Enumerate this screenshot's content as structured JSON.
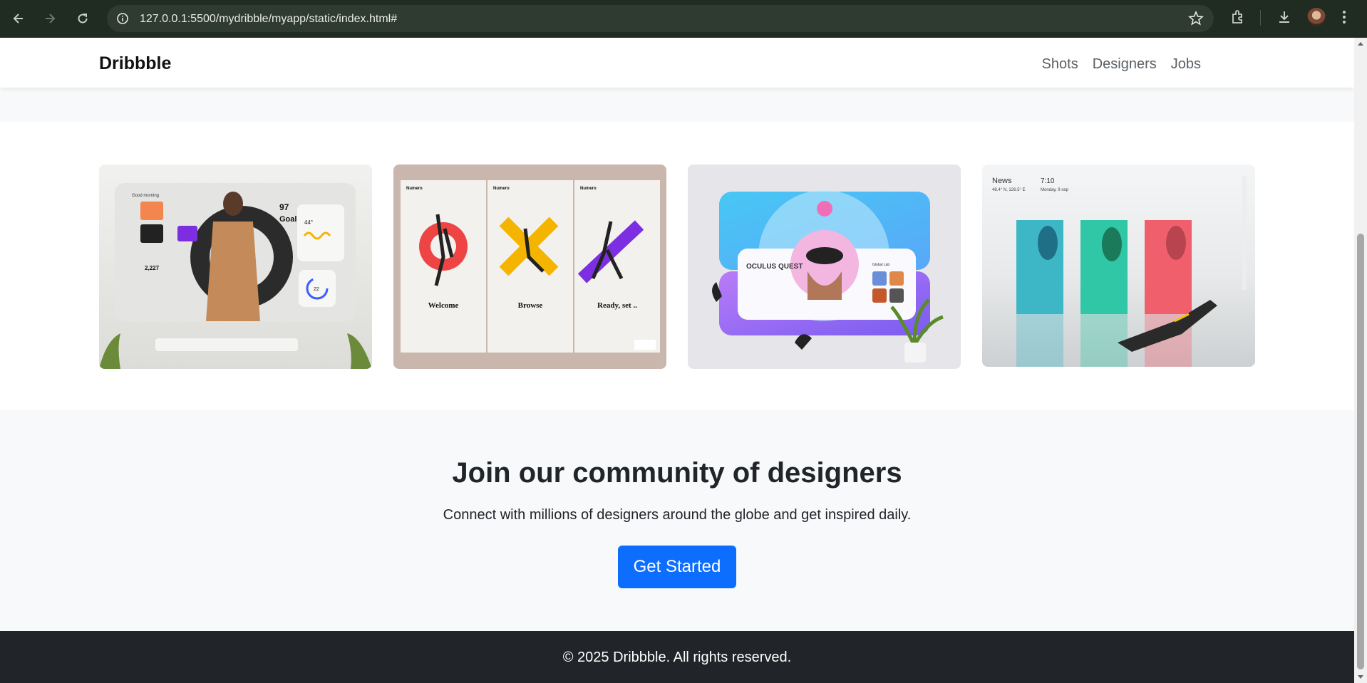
{
  "browser": {
    "url": "127.0.0.1:5500/mydribble/myapp/static/index.html#"
  },
  "navbar": {
    "brand": "Dribbble",
    "links": [
      "Shots",
      "Designers",
      "Jobs"
    ]
  },
  "shots": [
    {
      "name": "smart-mirror-shot",
      "icon": "image-icon",
      "lines": [
        "Good morning",
        "97",
        "Goal",
        "2,227",
        "44°",
        "22"
      ]
    },
    {
      "name": "numero-onboarding-shot",
      "icon": "image-icon",
      "lines": [
        "Numero",
        "Numero",
        "Numero",
        "Welcome",
        "Browse",
        "Ready, set .."
      ]
    },
    {
      "name": "oculus-quest-shot",
      "icon": "image-icon",
      "lines": [
        "OCULUS QUEST",
        "Global Lab"
      ]
    },
    {
      "name": "news-dashboard-shot",
      "icon": "image-icon",
      "lines": [
        "News",
        "7:10",
        "48.4° N, 126.5° E",
        "Monday, 9 sep"
      ]
    }
  ],
  "cta": {
    "title": "Join our community of designers",
    "subtitle": "Connect with millions of designers around the globe and get inspired daily.",
    "button": "Get Started"
  },
  "footer": {
    "text": "© 2025 Dribbble. All rights reserved."
  },
  "colors": {
    "chrome": "#202b21",
    "primary": "#0d6efd",
    "footer": "#212529"
  }
}
